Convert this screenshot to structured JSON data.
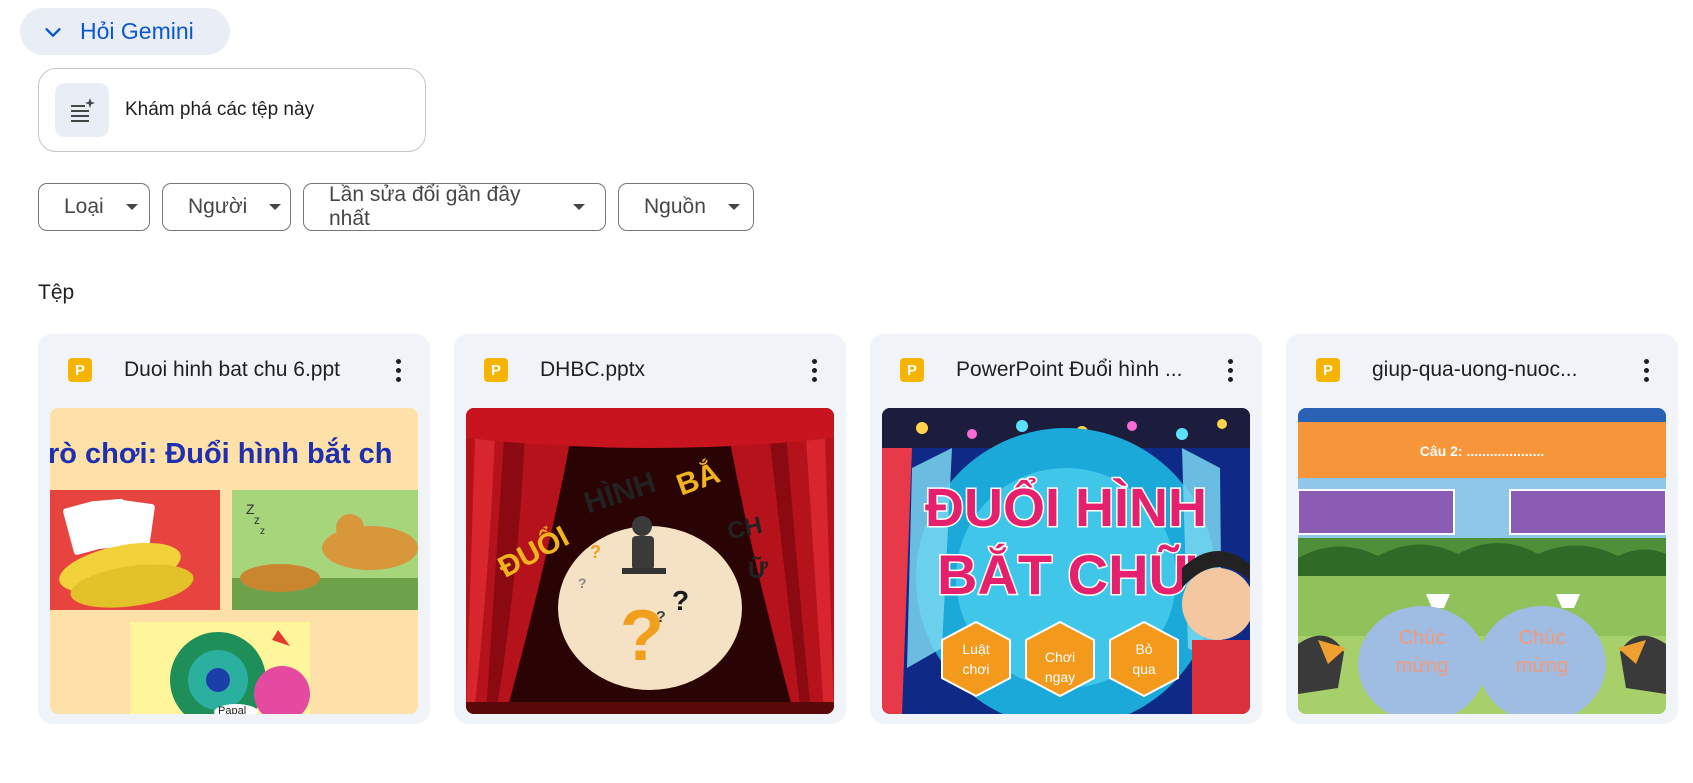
{
  "gemini": {
    "label": "Hỏi Gemini",
    "icon": "chevron-down-icon"
  },
  "explore": {
    "label": "Khám phá các tệp này",
    "icon": "list-sparkle-icon"
  },
  "filters": [
    {
      "label": "Loại"
    },
    {
      "label": "Người"
    },
    {
      "label": "Lần sửa đổi gần đây nhất"
    },
    {
      "label": "Nguồn"
    }
  ],
  "section": {
    "title": "Tệp"
  },
  "files": [
    {
      "name": "Duoi hinh bat chu 6.ppt",
      "type_badge": "P",
      "thumb_texts": [
        "rò chơi: Đuổi hình bắt ch",
        "Z",
        "z",
        "z",
        "Papal"
      ]
    },
    {
      "name": "DHBC.pptx",
      "type_badge": "P",
      "thumb_texts": [
        "ĐUỔI",
        "HÌNH",
        "BẮ",
        "CH",
        "Ữ",
        "?",
        "?",
        "?",
        "?",
        "?"
      ]
    },
    {
      "name": "PowerPoint Đuổi hình ...",
      "type_badge": "P",
      "thumb_texts": [
        "ĐUỔI HÌNH",
        "BẮT CHỮ",
        "Luật",
        "chơi",
        "Chơi",
        "ngay",
        "Bỏ",
        "qua"
      ]
    },
    {
      "name": "giup-qua-uong-nuoc...",
      "type_badge": "P",
      "thumb_texts": [
        "Câu 2: ....................",
        "Chúc",
        "mừng",
        "Chúc",
        "mừng"
      ]
    }
  ],
  "colors": {
    "accent": "#0b57d0",
    "ppt_badge": "#f4b400",
    "card_bg": "#f0f4f9"
  }
}
